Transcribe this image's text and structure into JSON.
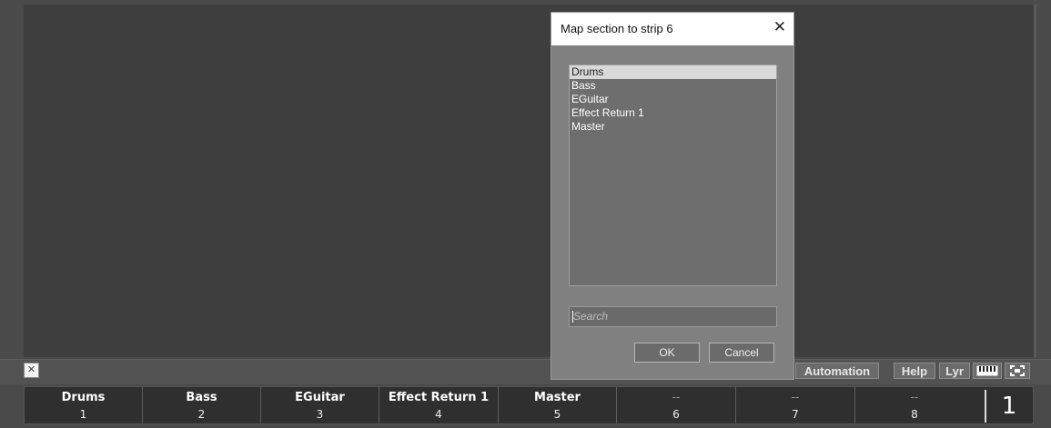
{
  "dialog": {
    "title": "Map section to strip 6",
    "close_glyph": "✕",
    "items": [
      "Drums",
      "Bass",
      "EGuitar",
      "Effect Return 1",
      "Master"
    ],
    "selected_index": 0,
    "search_placeholder": "Search",
    "ok_label": "OK",
    "cancel_label": "Cancel"
  },
  "toolbar": {
    "close_glyph": "✕",
    "automation_label": "Automation",
    "help_label": "Help",
    "lyr_label": "Lyr",
    "keyboard_icon": "piano-keyboard-icon",
    "fullscreen_icon": "fullscreen-icon",
    "grip_glyph": "⠿"
  },
  "strips": [
    {
      "name": "Drums",
      "number": "1"
    },
    {
      "name": "Bass",
      "number": "2"
    },
    {
      "name": "EGuitar",
      "number": "3"
    },
    {
      "name": "Effect Return 1",
      "number": "4"
    },
    {
      "name": "Master",
      "number": "5"
    },
    {
      "name": "--",
      "number": "6"
    },
    {
      "name": "--",
      "number": "7"
    },
    {
      "name": "--",
      "number": "8"
    }
  ],
  "bank_number": "1",
  "colors": {
    "background": "#4a4a4a",
    "canvas": "#3e3e3e",
    "dialog": "#808080",
    "selection": "#d9d9d9"
  }
}
